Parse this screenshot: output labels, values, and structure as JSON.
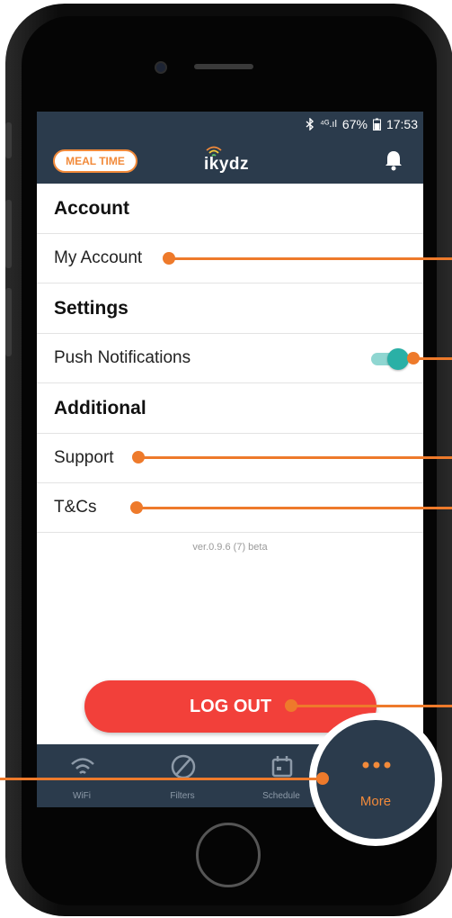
{
  "status_bar": {
    "signal": "⁴ᴳ.ıl",
    "battery": "67%",
    "time": "17:53"
  },
  "header": {
    "badge": "MEAL TIME",
    "logo": "ikydz"
  },
  "sections": {
    "account": "Account",
    "my_account": "My Account",
    "settings": "Settings",
    "push_notifications": "Push Notifications",
    "push_notifications_on": true,
    "additional": "Additional",
    "support": "Support",
    "tcs": "T&Cs"
  },
  "version": "ver.0.9.6 (7) beta",
  "logout_label": "LOG OUT",
  "tabs": {
    "wifi": "WiFi",
    "filters": "Filters",
    "schedule": "Schedule",
    "more": "More"
  },
  "colors": {
    "header": "#2b3b4c",
    "accent": "#f28a3a",
    "logout": "#f2403a",
    "toggle": "#2ab0a6",
    "callout": "#ee7a2b"
  },
  "icons": [
    "bluetooth-icon",
    "bell-icon",
    "wifi-icon",
    "block-icon",
    "calendar-icon",
    "more-dots-icon"
  ]
}
